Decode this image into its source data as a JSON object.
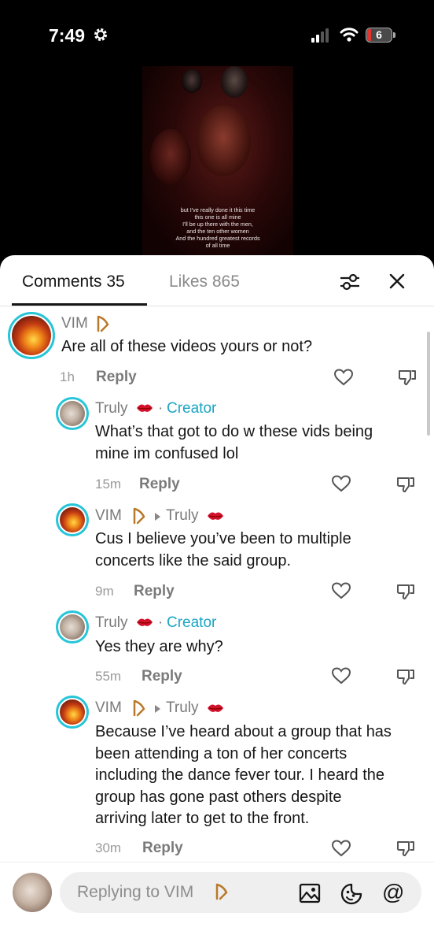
{
  "status": {
    "time": "7:49",
    "battery": "6"
  },
  "video": {
    "lyrics": [
      "but I've really done it this time",
      "this one is all mine",
      "I'll be up there with the men,",
      "and the ten other women",
      "And the hundred greatest records",
      "of all time"
    ]
  },
  "tabs": {
    "comments": "Comments 35",
    "likes": "Likes 865"
  },
  "comments": [
    {
      "name": "VIM",
      "badge": "harp",
      "text": "Are all of these videos yours or not?",
      "time": "1h",
      "reply": "Reply"
    },
    {
      "name": "Truly",
      "badge": "kiss",
      "creator": "Creator",
      "text_lines": [
        "What’s that got to do w these vids being",
        "mine im confused lol"
      ],
      "time": "15m",
      "reply": "Reply"
    },
    {
      "name": "VIM",
      "badge": "harp",
      "reply_to": "Truly",
      "text_lines": [
        "Cus I believe you’ve been to multiple",
        "concerts like the said group."
      ],
      "time": "9m",
      "reply": "Reply"
    },
    {
      "name": "Truly",
      "badge": "kiss",
      "creator": "Creator",
      "text": "Yes they are why?",
      "time": "55m",
      "reply": "Reply"
    },
    {
      "name": "VIM",
      "badge": "harp",
      "reply_to": "Truly",
      "text_lines": [
        "Because I’ve heard about a group that has",
        "been attending a ton of her concerts",
        "including the dance fever tour. I heard the",
        "group has gone past others despite",
        "arriving later to get to the front."
      ],
      "time": "30m",
      "reply": "Reply"
    }
  ],
  "input": {
    "placeholder": "Replying to VIM"
  },
  "colors": {
    "creator": "#1aa5c4",
    "avatar_ring": "#26c5d8"
  }
}
